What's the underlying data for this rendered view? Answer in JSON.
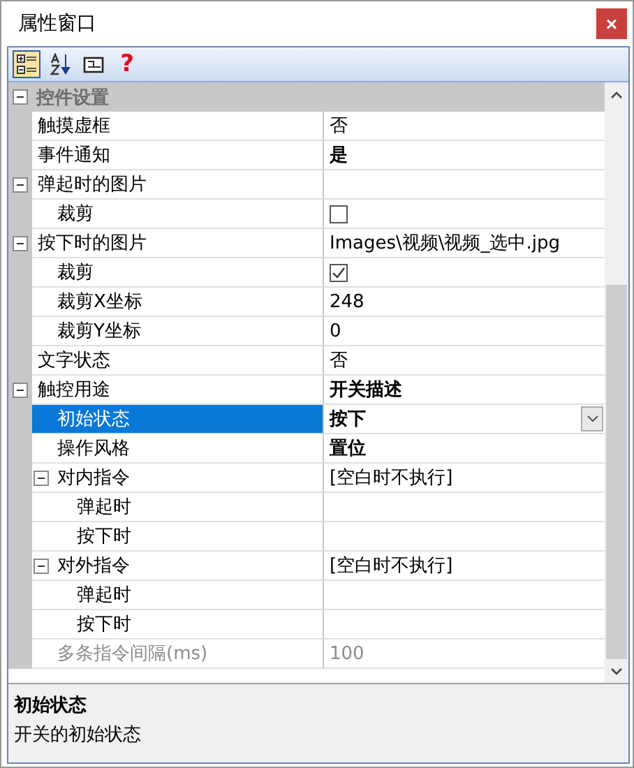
{
  "window": {
    "title": "属性窗口",
    "close": "×"
  },
  "toolbar": [
    {
      "kind": "categorized",
      "selected": true
    },
    {
      "kind": "alphabetical",
      "selected": false
    },
    {
      "kind": "pages",
      "selected": false
    },
    {
      "kind": "help",
      "glyph": "?",
      "selected": false
    }
  ],
  "grid": {
    "categories": [
      {
        "label": "控件设置",
        "expanded": true,
        "properties": [
          {
            "name": "触摸虚框",
            "kind": "text",
            "value": "否",
            "bold": false
          },
          {
            "name": "事件通知",
            "kind": "text",
            "value": "是",
            "bold": true
          },
          {
            "name": "弹起时的图片",
            "kind": "text",
            "expanded": true,
            "children": [
              {
                "name": "裁剪",
                "kind": "checkbox",
                "checked": false
              }
            ]
          },
          {
            "name": "按下时的图片",
            "kind": "text",
            "value": "Images\\视频\\视频_选中.jpg",
            "bold": false,
            "expanded": true,
            "children": [
              {
                "name": "裁剪",
                "kind": "checkbox",
                "checked": true
              },
              {
                "name": "裁剪X坐标",
                "kind": "text",
                "value": "248",
                "bold": false
              },
              {
                "name": "裁剪Y坐标",
                "kind": "text",
                "value": "0",
                "bold": false
              }
            ]
          },
          {
            "name": "文字状态",
            "kind": "text",
            "value": "否",
            "bold": false
          },
          {
            "name": "触控用途",
            "kind": "text",
            "value": "开关描述",
            "bold": true,
            "expanded": true,
            "children": [
              {
                "name": "初始状态",
                "kind": "dropdown",
                "value": "按下",
                "bold": true,
                "selected": true
              },
              {
                "name": "操作风格",
                "kind": "text",
                "value": "置位",
                "bold": true
              },
              {
                "name": "对内指令",
                "kind": "text",
                "value": "[空白时不执行]",
                "bold": false,
                "expanded": true,
                "children": [
                  {
                    "name": "弹起时"
                  },
                  {
                    "name": "按下时"
                  }
                ]
              },
              {
                "name": "对外指令",
                "kind": "text",
                "value": "[空白时不执行]",
                "bold": false,
                "expanded": true,
                "children": [
                  {
                    "name": "弹起时"
                  },
                  {
                    "name": "按下时"
                  }
                ]
              },
              {
                "name": "多条指令间隔(ms)",
                "kind": "text",
                "value": "100",
                "bold": false,
                "disabled": true
              }
            ]
          }
        ]
      }
    ]
  },
  "description": {
    "title": "初始状态",
    "text": "开关的初始状态"
  }
}
